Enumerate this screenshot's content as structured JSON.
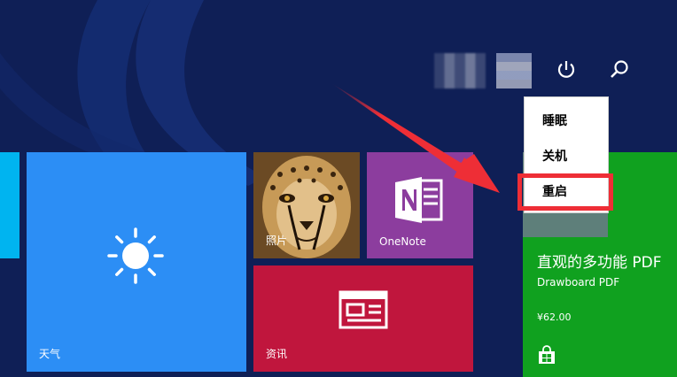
{
  "tiles": {
    "weather": {
      "label": "天气",
      "color": "#2c8ef5"
    },
    "photos": {
      "label": "照片",
      "color": "#7a5a2f"
    },
    "onenote": {
      "label": "OneNote",
      "color": "#8c3d9e"
    },
    "news": {
      "label": "资讯",
      "color": "#c0163d"
    },
    "store": {
      "title": "直观的多功能 PDF",
      "app_name": "Drawboard PDF",
      "price": "¥62.00",
      "color": "#10a11f"
    }
  },
  "power_menu": {
    "items": [
      {
        "label": "睡眠"
      },
      {
        "label": "关机"
      },
      {
        "label": "重启"
      }
    ]
  },
  "icons": {
    "power": "power-icon",
    "search": "search-icon"
  },
  "colors": {
    "background": "#0f1f56",
    "highlight": "#ee2e36"
  }
}
